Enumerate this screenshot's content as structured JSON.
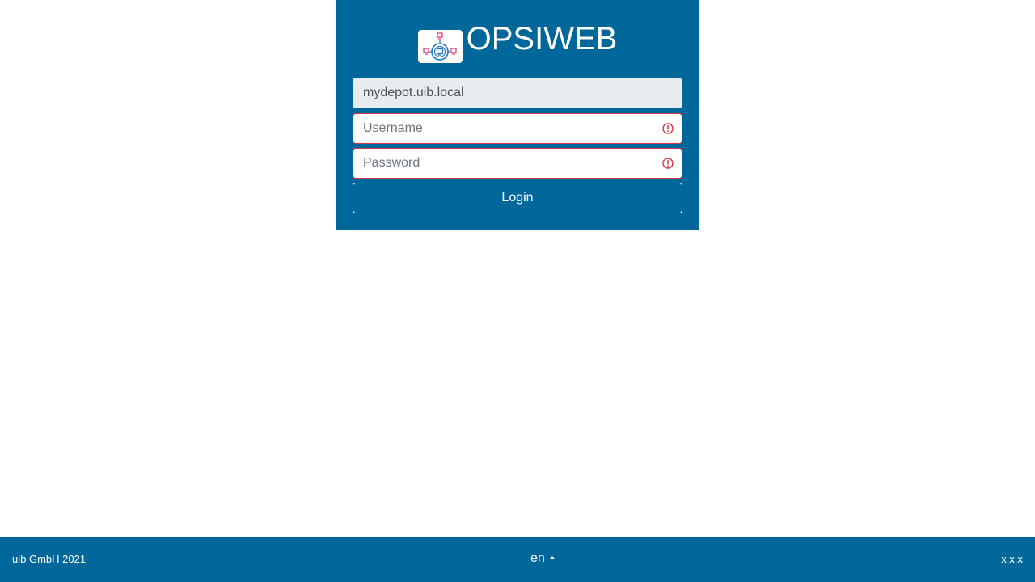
{
  "brand": {
    "title": "OPSIWEB",
    "logo_icon": "opsi-network-logo-icon"
  },
  "form": {
    "depot_value": "mydepot.uib.local",
    "username_placeholder": "Username",
    "password_placeholder": "Password",
    "login_label": "Login",
    "invalid_icon": "exclamation-circle-icon"
  },
  "footer": {
    "copyright": "uib GmbH 2021",
    "language": "en",
    "language_icon": "caret-up-icon",
    "version": "x.x.x"
  },
  "colors": {
    "primary": "#00679a",
    "invalid": "#dc3545",
    "readonly_bg": "#e9ecef",
    "logo_pink": "#e0306e",
    "logo_blue": "#1b75bc"
  }
}
